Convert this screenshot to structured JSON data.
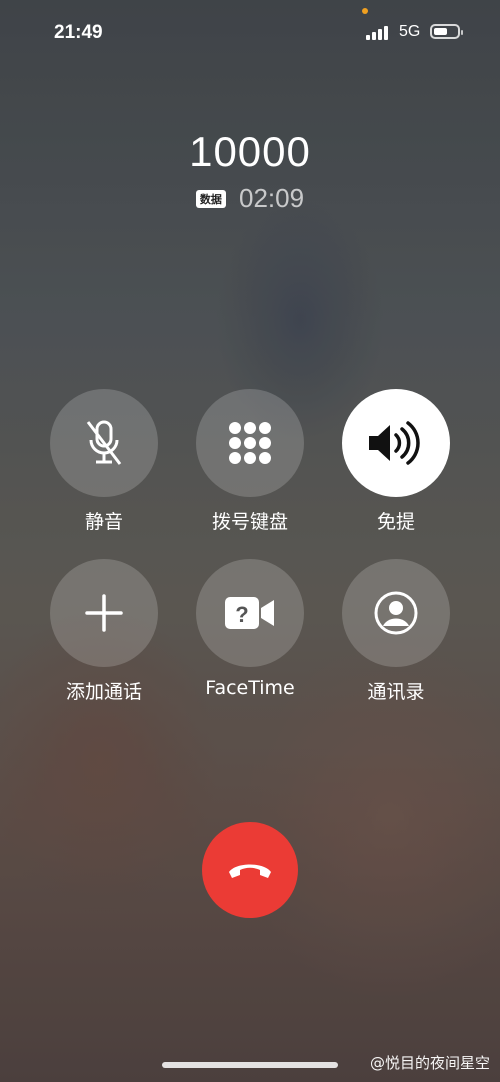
{
  "status_bar": {
    "time": "21:49",
    "network": "5G",
    "battery_level": 0.5
  },
  "call": {
    "number": "10000",
    "badge": "数据",
    "duration": "02:09"
  },
  "controls": [
    {
      "label": "静音",
      "icon": "mic-off-icon"
    },
    {
      "label": "拨号键盘",
      "icon": "keypad-icon"
    },
    {
      "label": "免提",
      "icon": "speaker-icon",
      "active": true
    },
    {
      "label": "添加通话",
      "icon": "plus-icon"
    },
    {
      "label": "FaceTime",
      "icon": "facetime-icon"
    },
    {
      "label": "通讯录",
      "icon": "contacts-icon"
    }
  ],
  "end_call": {
    "icon": "end-call-icon",
    "color": "#eb3b35"
  },
  "watermark": "@悦目的夜间星空"
}
